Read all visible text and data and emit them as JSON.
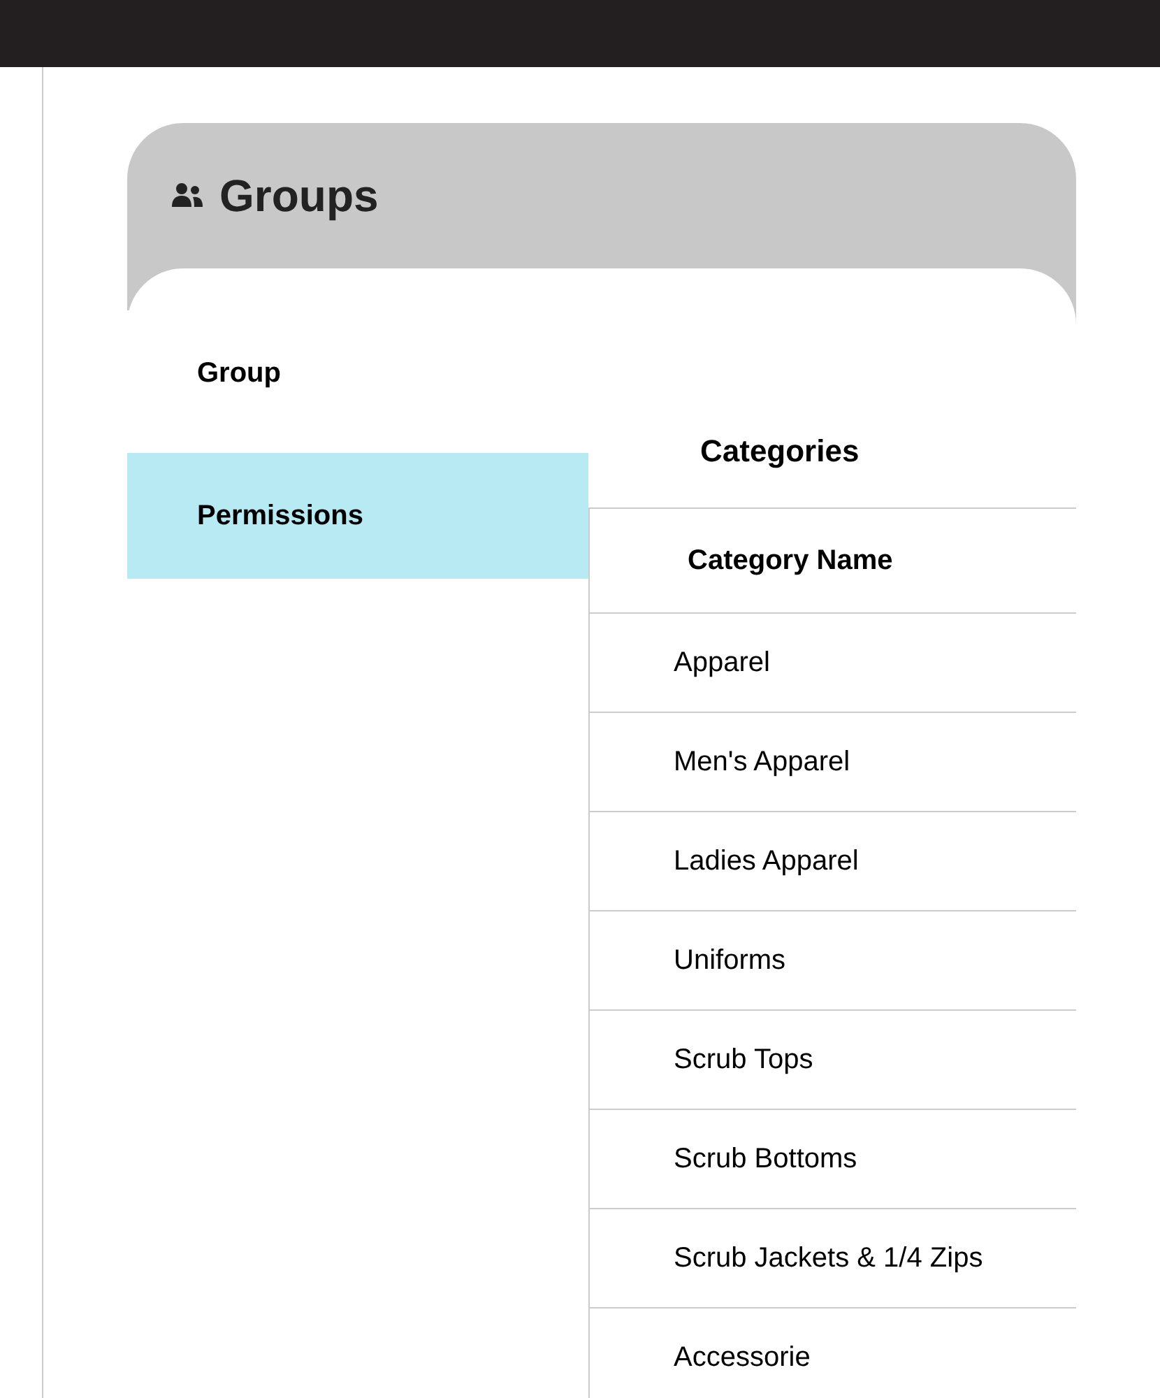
{
  "panel": {
    "title": "Groups"
  },
  "tabs": [
    {
      "label": "Group",
      "selected": false
    },
    {
      "label": "Permissions",
      "selected": true
    }
  ],
  "section": {
    "title": "Categories"
  },
  "table": {
    "columns": [
      "Category Name"
    ],
    "rows": [
      [
        "Apparel"
      ],
      [
        "Men's Apparel"
      ],
      [
        "Ladies Apparel"
      ],
      [
        "Uniforms"
      ],
      [
        "Scrub Tops"
      ],
      [
        "Scrub Bottoms"
      ],
      [
        "Scrub Jackets & 1/4 Zips"
      ],
      [
        "Accessorie"
      ]
    ]
  }
}
